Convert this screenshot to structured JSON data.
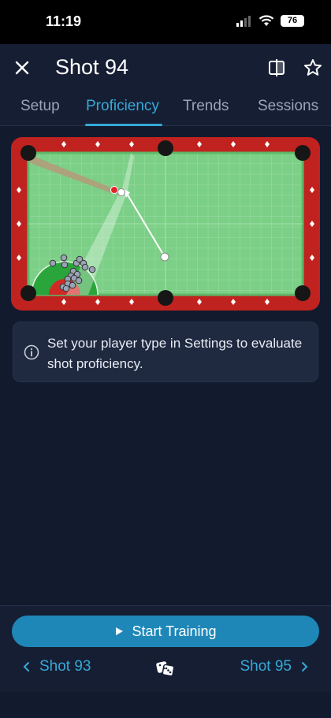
{
  "status": {
    "time": "11:19",
    "battery": "76"
  },
  "header": {
    "title": "Shot 94",
    "close_icon": "close-icon",
    "compare_icon": "compare-icon",
    "favorite_icon": "star-icon"
  },
  "tabs": [
    {
      "label": "Setup",
      "active": false
    },
    {
      "label": "Proficiency",
      "active": true
    },
    {
      "label": "Trends",
      "active": false
    },
    {
      "label": "Sessions",
      "active": false
    }
  ],
  "info": {
    "text": "Set your player type in Settings to evaluate shot proficiency."
  },
  "actions": {
    "start_label": "Start Training",
    "prev_label": "Shot 93",
    "next_label": "Shot 95"
  },
  "colors": {
    "accent": "#36a9d8",
    "button": "#1e87b8",
    "felt": "#7ccf86",
    "rail": "#c0231f",
    "background": "#121a2e"
  }
}
